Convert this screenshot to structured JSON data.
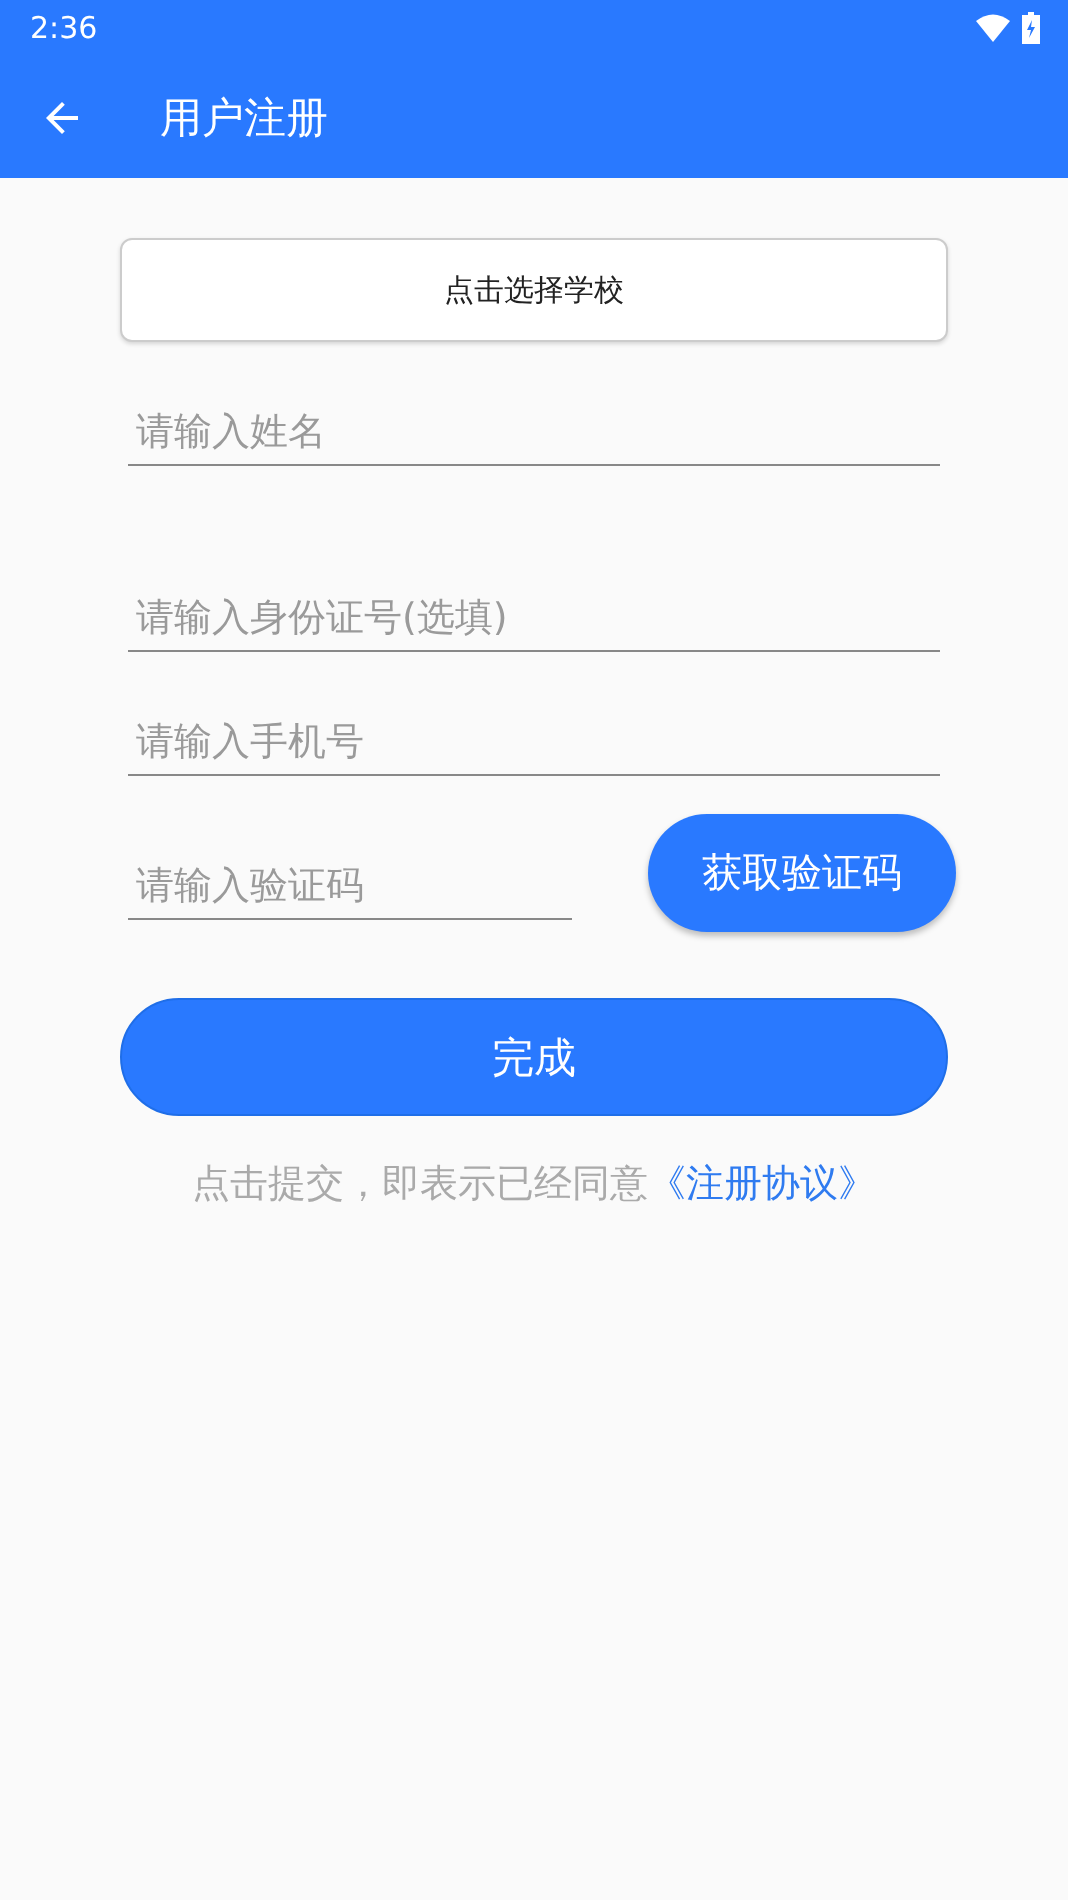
{
  "status_bar": {
    "time": "2:36"
  },
  "app_bar": {
    "title": "用户注册"
  },
  "school_button": {
    "label": "点击选择学校"
  },
  "fields": [
    {
      "placeholder": "请输入姓名"
    },
    {
      "placeholder": "请输入身份证号(选填)"
    },
    {
      "placeholder": "请输入手机号"
    }
  ],
  "code_field": {
    "placeholder": "请输入验证码"
  },
  "code_button": {
    "label": "获取验证码"
  },
  "submit_button": {
    "label": "完成"
  },
  "agreement": {
    "text": "点击提交，即表示已经同意",
    "link": "《注册协议》"
  }
}
